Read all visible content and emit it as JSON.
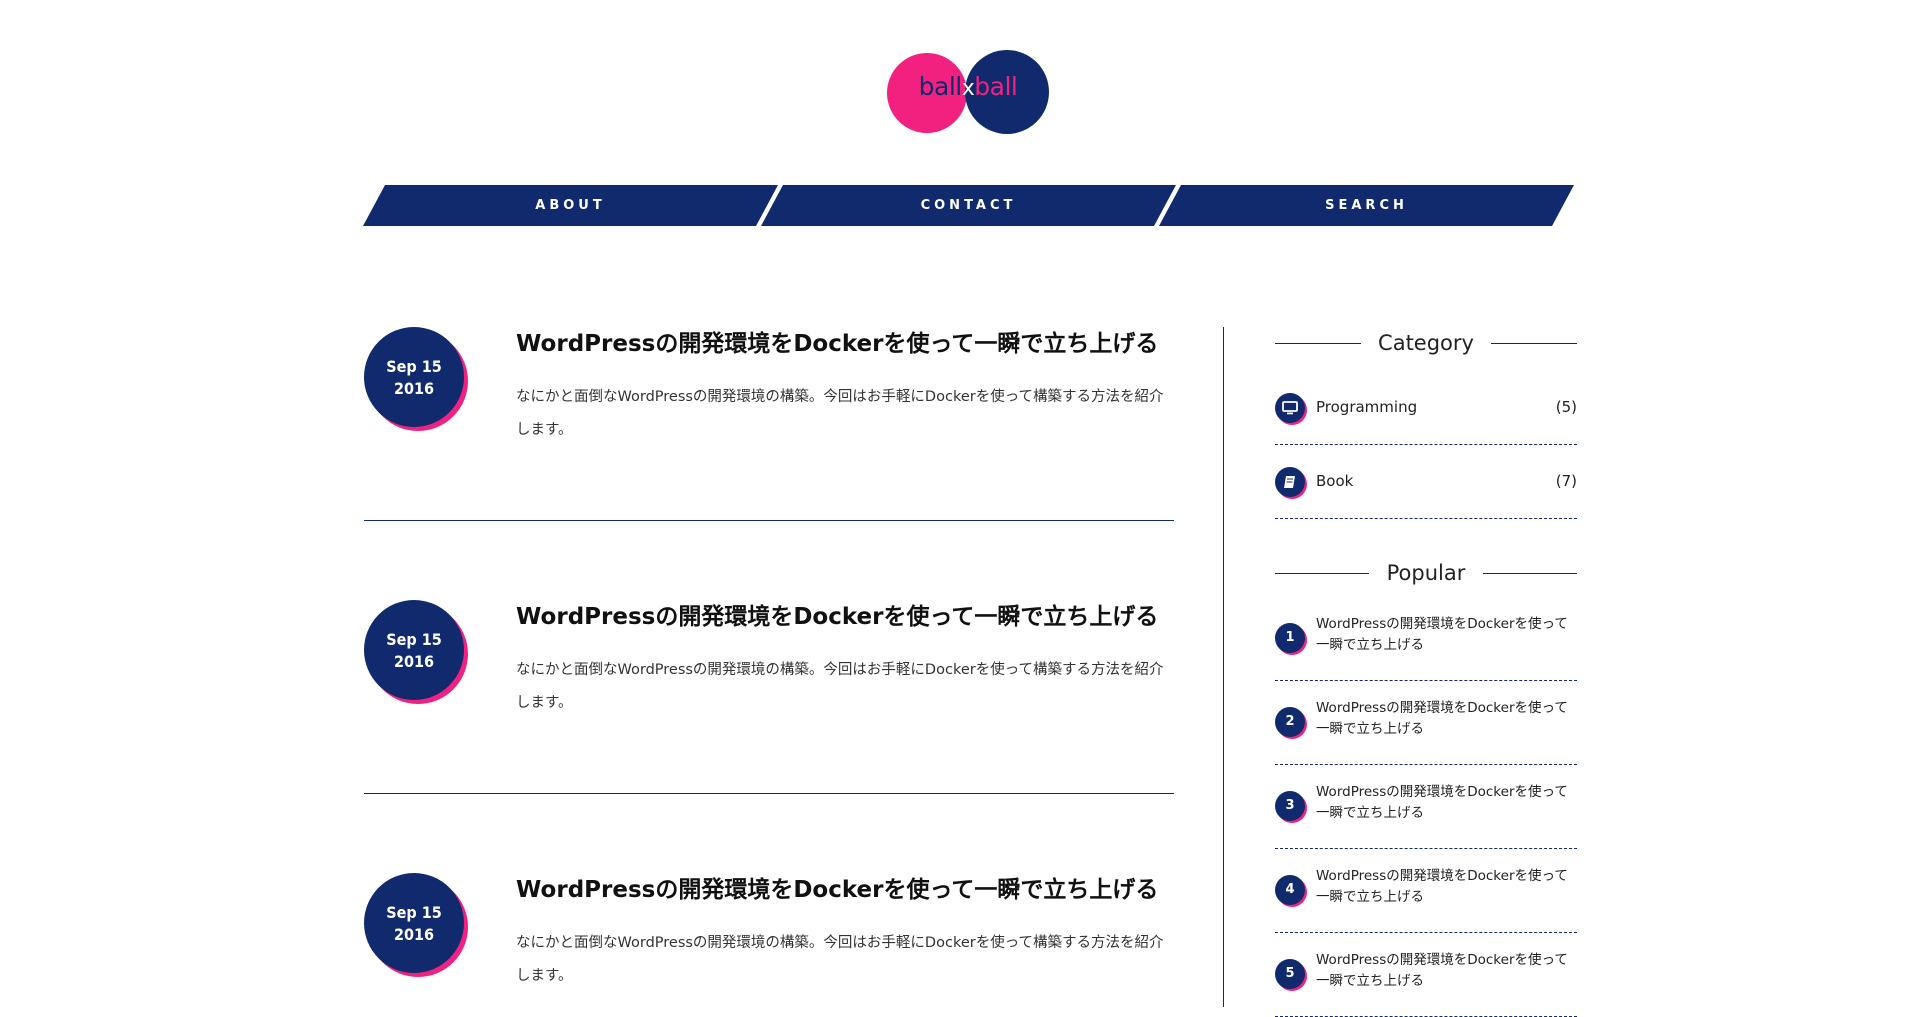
{
  "logo": {
    "part1": "ball",
    "separator": "x",
    "part2": "ball"
  },
  "nav": {
    "items": [
      "ABOUT",
      "CONTACT",
      "SEARCH"
    ]
  },
  "posts": [
    {
      "date_md": "Sep 15",
      "date_year": "2016",
      "title": "WordPressの開発環境をDockerを使って一瞬で立ち上げる",
      "excerpt": "なにかと面倒なWordPressの開発環境の構築。今回はお手軽にDockerを使って構築する方法を紹介します。"
    },
    {
      "date_md": "Sep 15",
      "date_year": "2016",
      "title": "WordPressの開発環境をDockerを使って一瞬で立ち上げる",
      "excerpt": "なにかと面倒なWordPressの開発環境の構築。今回はお手軽にDockerを使って構築する方法を紹介します。"
    },
    {
      "date_md": "Sep 15",
      "date_year": "2016",
      "title": "WordPressの開発環境をDockerを使って一瞬で立ち上げる",
      "excerpt": "なにかと面倒なWordPressの開発環境の構築。今回はお手軽にDockerを使って構築する方法を紹介します。"
    }
  ],
  "sidebar": {
    "category": {
      "title": "Category",
      "items": [
        {
          "label": "Programming",
          "count": "(5)",
          "icon": "monitor-icon"
        },
        {
          "label": "Book",
          "count": "(7)",
          "icon": "book-icon"
        }
      ]
    },
    "popular": {
      "title": "Popular",
      "items": [
        {
          "rank": "1",
          "title": "WordPressの開発環境をDockerを使って一瞬で立ち上げる"
        },
        {
          "rank": "2",
          "title": "WordPressの開発環境をDockerを使って一瞬で立ち上げる"
        },
        {
          "rank": "3",
          "title": "WordPressの開発環境をDockerを使って一瞬で立ち上げる"
        },
        {
          "rank": "4",
          "title": "WordPressの開発環境をDockerを使って一瞬で立ち上げる"
        },
        {
          "rank": "5",
          "title": "WordPressの開発環境をDockerを使って一瞬で立ち上げる"
        }
      ]
    }
  },
  "colors": {
    "navy": "#102a6d",
    "pink": "#f2217f"
  }
}
